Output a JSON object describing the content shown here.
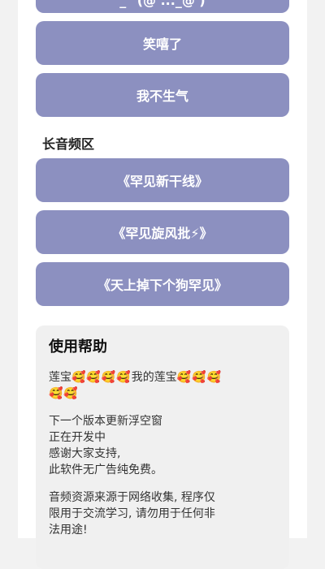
{
  "buttons": {
    "cut_top": "^_^(@ ..._@ )^",
    "items": [
      {
        "label": "笑嘻了"
      },
      {
        "label": "我不生气"
      }
    ]
  },
  "long_section": {
    "title": "长音频区",
    "items": [
      {
        "label": "《罕见新干线》"
      },
      {
        "label": "《罕见旋风批⚡》"
      },
      {
        "label": "《天上掉下个狗罕见》"
      }
    ]
  },
  "help": {
    "title": "使用帮助",
    "line1_prefix": "莲宝",
    "line1_emojis_a": "🥰🥰🥰🥰",
    "line1_mid": "我的莲宝",
    "line1_emojis_b": "🥰🥰🥰",
    "line2_emojis": "🥰🥰",
    "para2": [
      "下一个版本更新浮空窗",
      "正在开发中",
      "感谢大家支持,",
      "此软件无广告纯免费。"
    ],
    "para3": [
      "音频资源来源于网络收集, 程序仅",
      "限用于交流学习, 请勿用于任何非",
      "法用途!"
    ]
  },
  "colors": {
    "button_bg": "#8c90c0",
    "page_bg": "#f2f2f2",
    "card_bg": "#f0f0f0"
  }
}
